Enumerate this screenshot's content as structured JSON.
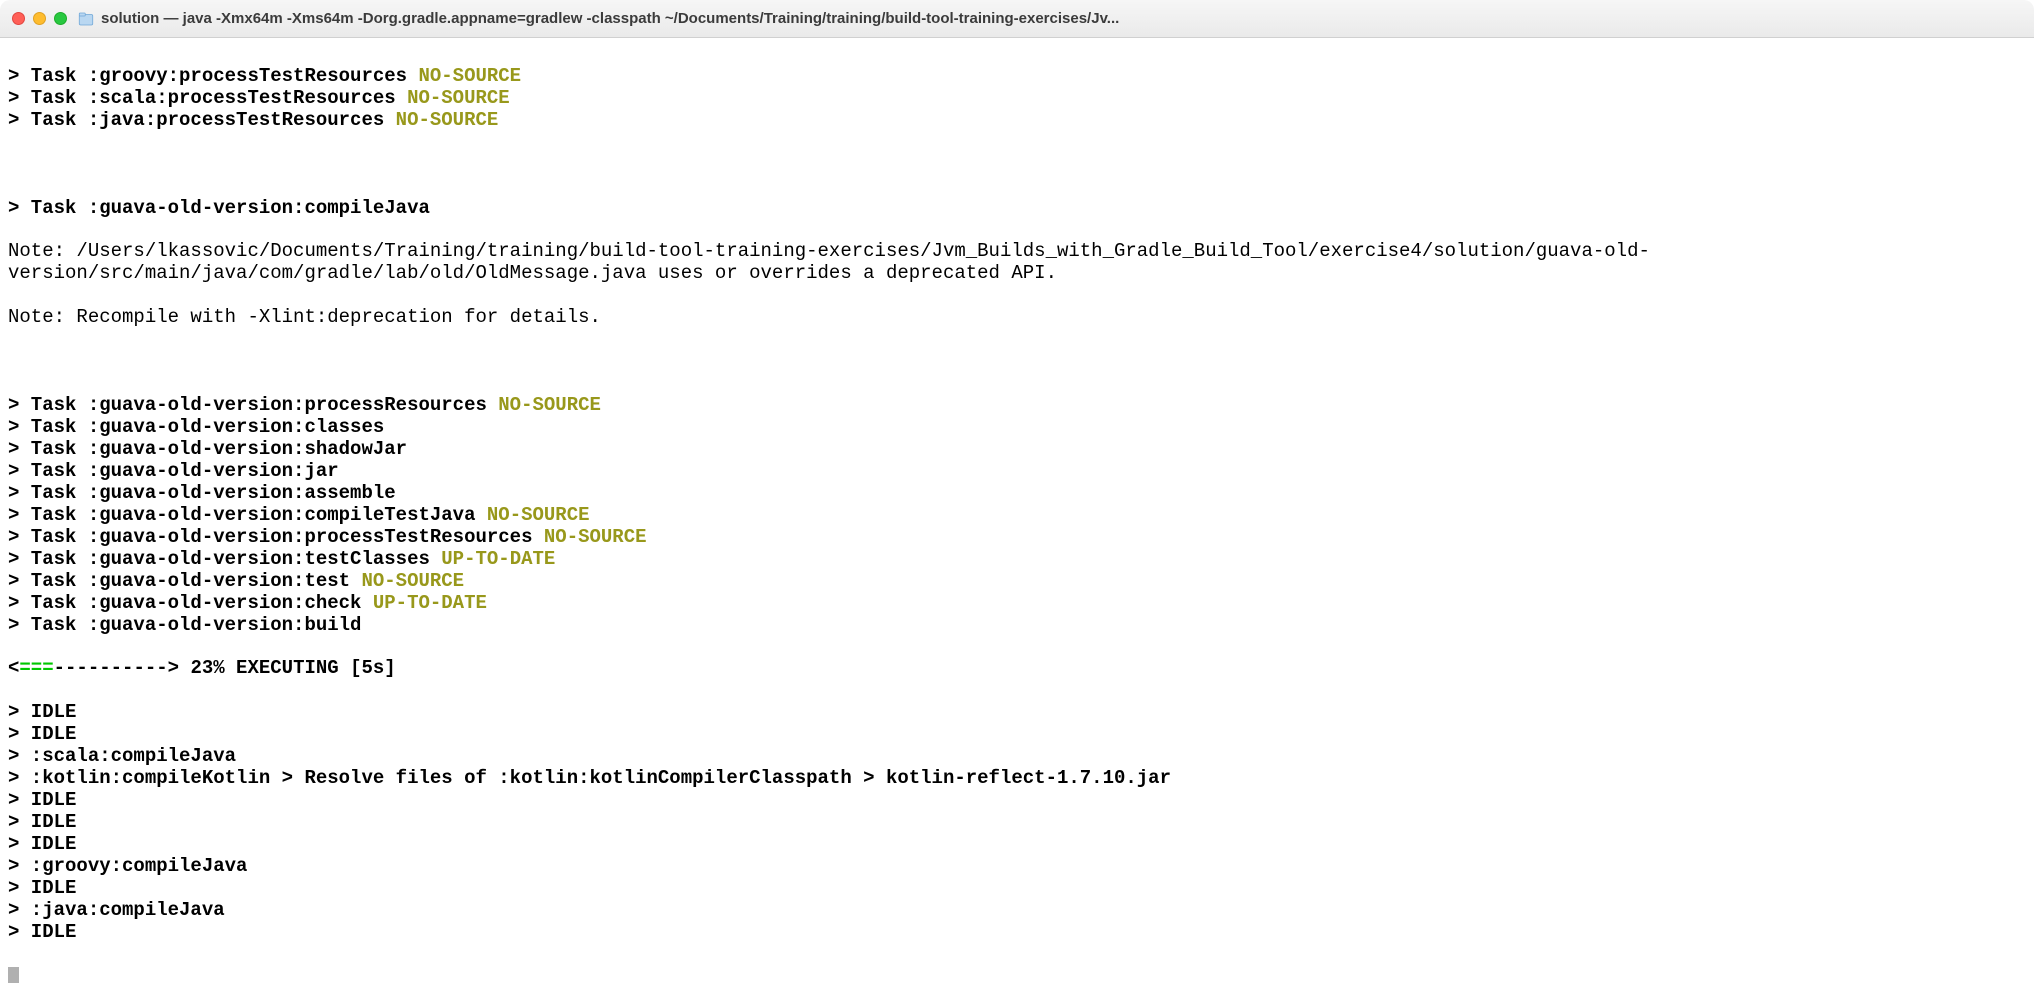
{
  "window": {
    "title": "solution — java -Xmx64m -Xms64m -Dorg.gradle.appname=gradlew -classpath ~/Documents/Training/training/build-tool-training-exercises/Jv..."
  },
  "status": {
    "no_source": "NO-SOURCE",
    "up_to_date": "UP-TO-DATE"
  },
  "tasks_top": [
    {
      "name": "> Task :groovy:processTestResources ",
      "status": "NO-SOURCE"
    },
    {
      "name": "> Task :scala:processTestResources ",
      "status": "NO-SOURCE"
    },
    {
      "name": "> Task :java:processTestResources ",
      "status": "NO-SOURCE"
    }
  ],
  "compile_header": "> Task :guava-old-version:compileJava",
  "note1": "Note: /Users/lkassovic/Documents/Training/training/build-tool-training-exercises/Jvm_Builds_with_Gradle_Build_Tool/exercise4/solution/guava-old-version/src/main/java/com/gradle/lab/old/OldMessage.java uses or overrides a deprecated API.",
  "note2": "Note: Recompile with -Xlint:deprecation for details.",
  "tasks_mid": [
    {
      "name": "> Task :guava-old-version:processResources ",
      "status": "NO-SOURCE"
    },
    {
      "name": "> Task :guava-old-version:classes",
      "status": ""
    },
    {
      "name": "> Task :guava-old-version:shadowJar",
      "status": ""
    },
    {
      "name": "> Task :guava-old-version:jar",
      "status": ""
    },
    {
      "name": "> Task :guava-old-version:assemble",
      "status": ""
    },
    {
      "name": "> Task :guava-old-version:compileTestJava ",
      "status": "NO-SOURCE"
    },
    {
      "name": "> Task :guava-old-version:processTestResources ",
      "status": "NO-SOURCE"
    },
    {
      "name": "> Task :guava-old-version:testClasses ",
      "status": "UP-TO-DATE"
    },
    {
      "name": "> Task :guava-old-version:test ",
      "status": "NO-SOURCE"
    },
    {
      "name": "> Task :guava-old-version:check ",
      "status": "UP-TO-DATE"
    },
    {
      "name": "> Task :guava-old-version:build",
      "status": ""
    }
  ],
  "progress": {
    "lt": "<",
    "bar_done": "===",
    "bar_rest": "---------->",
    "text": " 23% EXECUTING [5s]"
  },
  "workers": [
    "> IDLE",
    "> IDLE",
    "> :scala:compileJava",
    "> :kotlin:compileKotlin > Resolve files of :kotlin:kotlinCompilerClasspath > kotlin-reflect-1.7.10.jar",
    "> IDLE",
    "> IDLE",
    "> IDLE",
    "> :groovy:compileJava",
    "> IDLE",
    "> :java:compileJava",
    "> IDLE"
  ]
}
